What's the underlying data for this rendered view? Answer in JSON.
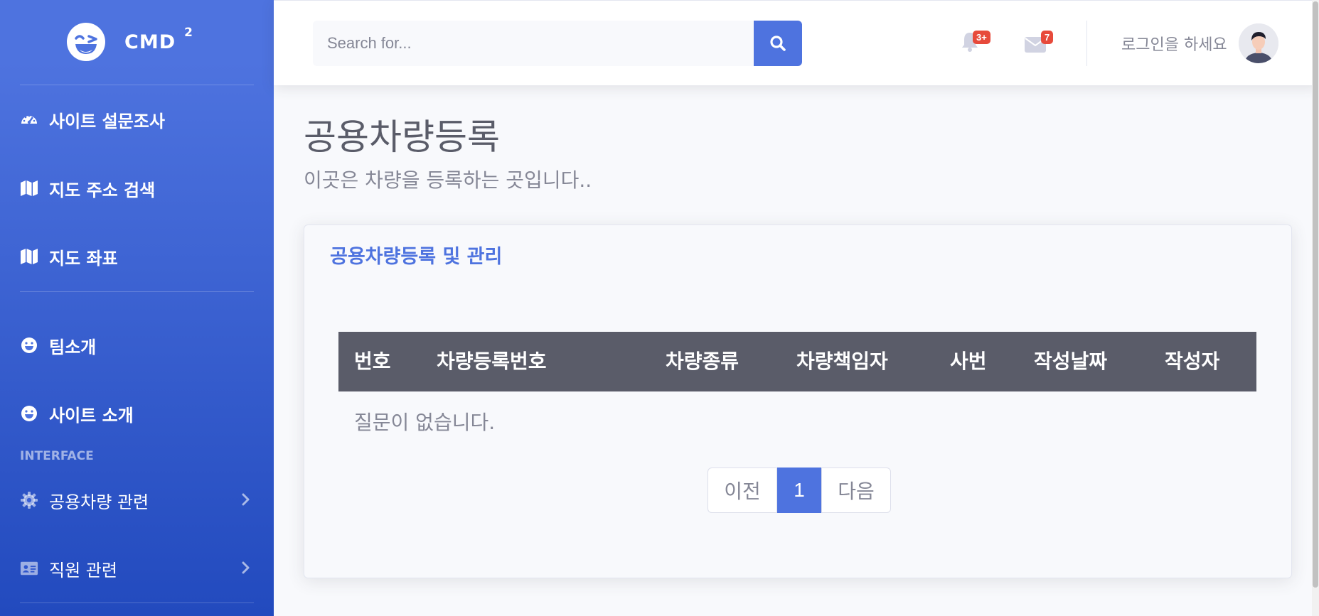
{
  "brand": {
    "name": "CMD",
    "superscript": "2"
  },
  "sidebar": {
    "items": [
      {
        "label": "사이트 설문조사",
        "icon": "tachometer-icon"
      },
      {
        "label": "지도 주소 검색",
        "icon": "map-icon"
      },
      {
        "label": "지도 좌표",
        "icon": "map-icon"
      },
      {
        "label": "팀소개",
        "icon": "smile-icon"
      },
      {
        "label": "사이트 소개",
        "icon": "smile-icon"
      }
    ],
    "heading": "INTERFACE",
    "collapsibles": [
      {
        "label": "공용차량 관련",
        "icon": "gear-icon"
      },
      {
        "label": "직원 관련",
        "icon": "id-card-icon"
      }
    ]
  },
  "topbar": {
    "search_placeholder": "Search for...",
    "alerts_badge": "3+",
    "messages_badge": "7",
    "user_name": "로그인을 하세요"
  },
  "page": {
    "title": "공용차량등록",
    "subtitle": "이곳은 차량을 등록하는 곳입니다.."
  },
  "card": {
    "title": "공용차량등록 및 관리",
    "columns": [
      "번호",
      "차량등록번호",
      "차량종류",
      "차량책임자",
      "사번",
      "작성날짜",
      "작성자"
    ],
    "empty_message": "질문이 없습니다.",
    "pagination": {
      "prev": "이전",
      "current": "1",
      "next": "다음"
    }
  },
  "colors": {
    "primary": "#4e73df",
    "danger": "#e74a3b",
    "table_header": "#5a5c69"
  }
}
